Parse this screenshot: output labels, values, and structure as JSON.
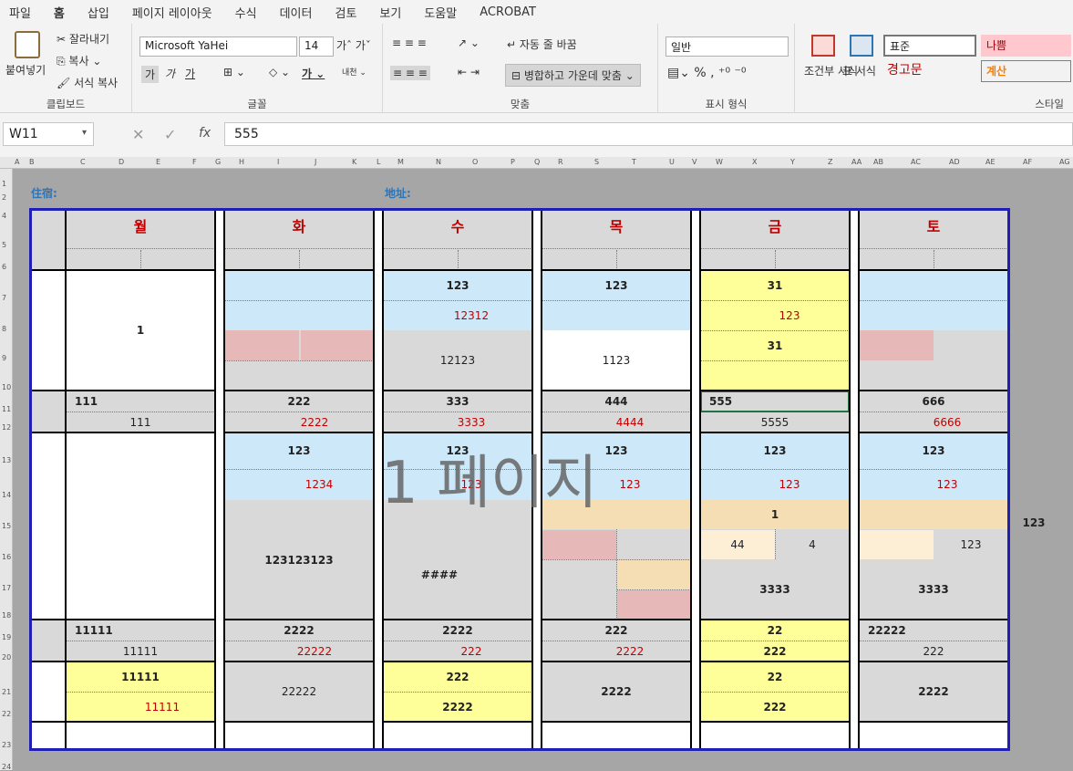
{
  "menu": [
    "파일",
    "홈",
    "삽입",
    "페이지 레이아웃",
    "수식",
    "데이터",
    "검토",
    "보기",
    "도움말",
    "ACROBAT"
  ],
  "ribbon": {
    "clipboard": {
      "paste": "붙여넣기",
      "cut": "잘라내기",
      "copy": "복사",
      "format_painter": "서식 복사",
      "label": "클립보드"
    },
    "font": {
      "name": "Microsoft YaHei",
      "size": "14",
      "bold": "가",
      "italic": "가",
      "underline": "가",
      "label": "글꼴"
    },
    "align": {
      "wrap": "자동 줄 바꿈",
      "merge": "병합하고 가운데 맞춤",
      "label": "맞춤"
    },
    "number": {
      "format": "일반",
      "label": "표시 형식"
    },
    "styles": {
      "cond": "조건부 서식",
      "table": "표 서식",
      "normal": "표준",
      "bad": "나쁨",
      "warning": "경고문",
      "calc": "계산",
      "label": "스타일"
    }
  },
  "formula_bar": {
    "name_box": "W11",
    "value": "555"
  },
  "columns": [
    "A",
    "B",
    "C",
    "D",
    "E",
    "F",
    "G",
    "H",
    "I",
    "J",
    "K",
    "L",
    "M",
    "N",
    "O",
    "P",
    "Q",
    "R",
    "S",
    "T",
    "U",
    "V",
    "W",
    "X",
    "Y",
    "Z",
    "AA",
    "AB",
    "AC",
    "AD",
    "AE",
    "AF",
    "AG"
  ],
  "rows": [
    "1",
    "2",
    "4",
    "5",
    "6",
    "7",
    "8",
    "9",
    "10",
    "11",
    "12",
    "13",
    "14",
    "15",
    "16",
    "17",
    "18",
    "19",
    "20",
    "21",
    "22",
    "23",
    "24"
  ],
  "sheet": {
    "label_left": "住宿:",
    "label_mid": "地址:",
    "days": [
      "월",
      "화",
      "수",
      "목",
      "금",
      "토"
    ],
    "watermark": "1 페이지",
    "side_value": "123",
    "mon": {
      "big": "1",
      "r11": "111",
      "r12": "111",
      "r19": "11111",
      "r20": "11111",
      "r21": "11111",
      "r22": "11111"
    },
    "tue": {
      "r11": "222",
      "r12": "2222",
      "r13": "123",
      "r14": "1234",
      "mid": "123123123",
      "r19": "2222",
      "r20": "22222",
      "r21": "22222"
    },
    "wed": {
      "r7": "123",
      "r8": "12312",
      "r9": "12123",
      "r11": "333",
      "r12": "3333",
      "r13": "123",
      "r14": "123",
      "mid": "####",
      "r19": "2222",
      "r20": "222",
      "r21": "222",
      "r22": "2222"
    },
    "thu": {
      "r7": "123",
      "r9": "1123",
      "r11": "444",
      "r12": "4444",
      "r13": "123",
      "r14": "123",
      "r19": "222",
      "r20": "2222",
      "r21": "2222"
    },
    "fri": {
      "r7": "31",
      "r8": "123",
      "r9": "31",
      "r11": "555",
      "r12": "5555",
      "r13": "123",
      "r14": "123",
      "r15": "1",
      "r16a": "44",
      "r16b": "4",
      "r17": "3333",
      "r19": "22",
      "r20": "222",
      "r21": "22",
      "r22": "222"
    },
    "sat": {
      "r11": "666",
      "r12": "6666",
      "r13": "123",
      "r14": "123",
      "r16": "123",
      "r17": "3333",
      "r19": "22222",
      "r20": "222",
      "r21": "2222"
    }
  }
}
